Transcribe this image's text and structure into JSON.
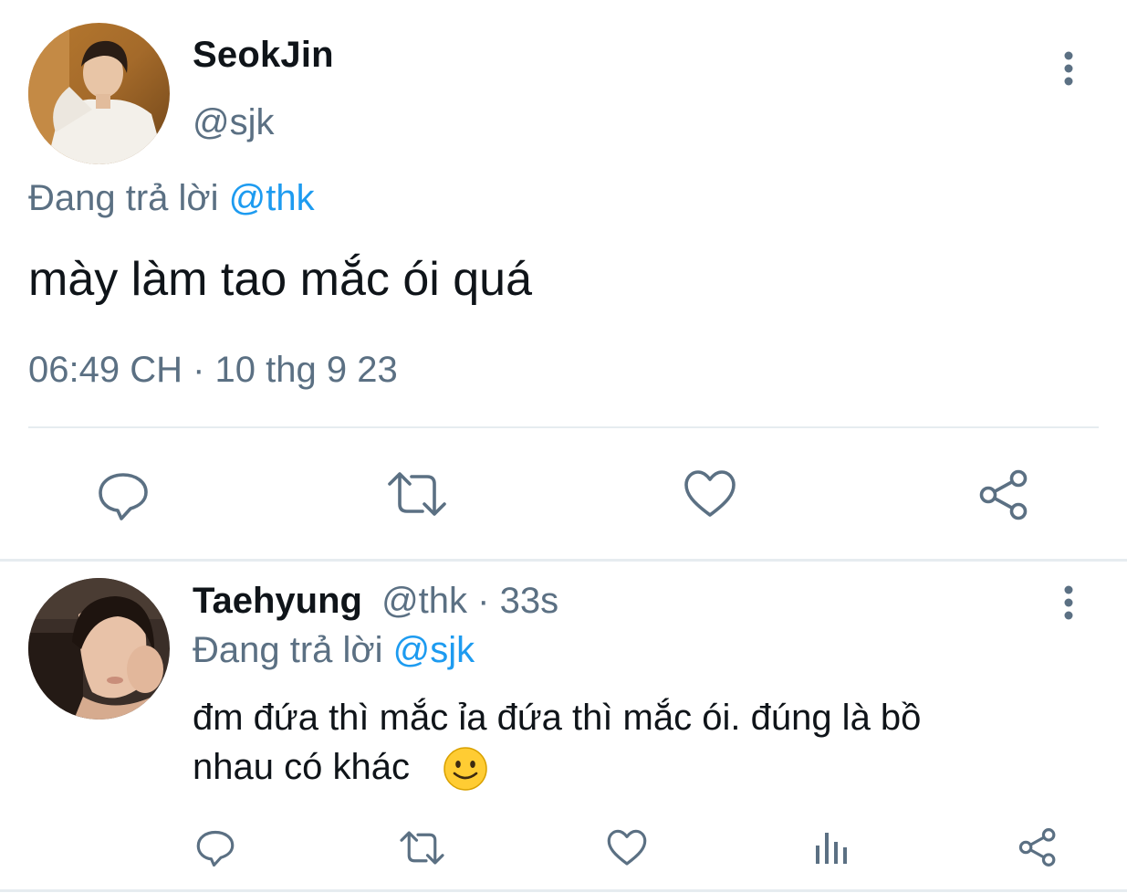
{
  "main_tweet": {
    "display_name": "SeokJin",
    "handle": "@sjk",
    "replying_prefix": "Đang trả lời",
    "replying_to": "@thk",
    "text": "mày làm tao mắc ói quá",
    "timestamp": "06:49 CH · 10 thg 9 23",
    "icons": [
      "more-vertical-icon",
      "reply-icon",
      "retweet-icon",
      "like-icon",
      "share-icon"
    ]
  },
  "reply_tweet": {
    "display_name": "Taehyung",
    "handle_time": "@thk · 33s",
    "replying_prefix": "Đang trả lời",
    "replying_to": "@sjk",
    "text_line1": "đm đứa thì mắc ỉa đứa thì mắc ói.  đúng là bồ",
    "text_line2": "nhau có khác",
    "emoji": "🙂",
    "icons": [
      "more-vertical-icon",
      "reply-icon",
      "retweet-icon",
      "like-icon",
      "analytics-icon",
      "share-icon"
    ]
  },
  "colors": {
    "text": "#0f1419",
    "secondary": "#5b7083",
    "accent": "#1d9bf0",
    "divider": "#e6ecf0"
  }
}
